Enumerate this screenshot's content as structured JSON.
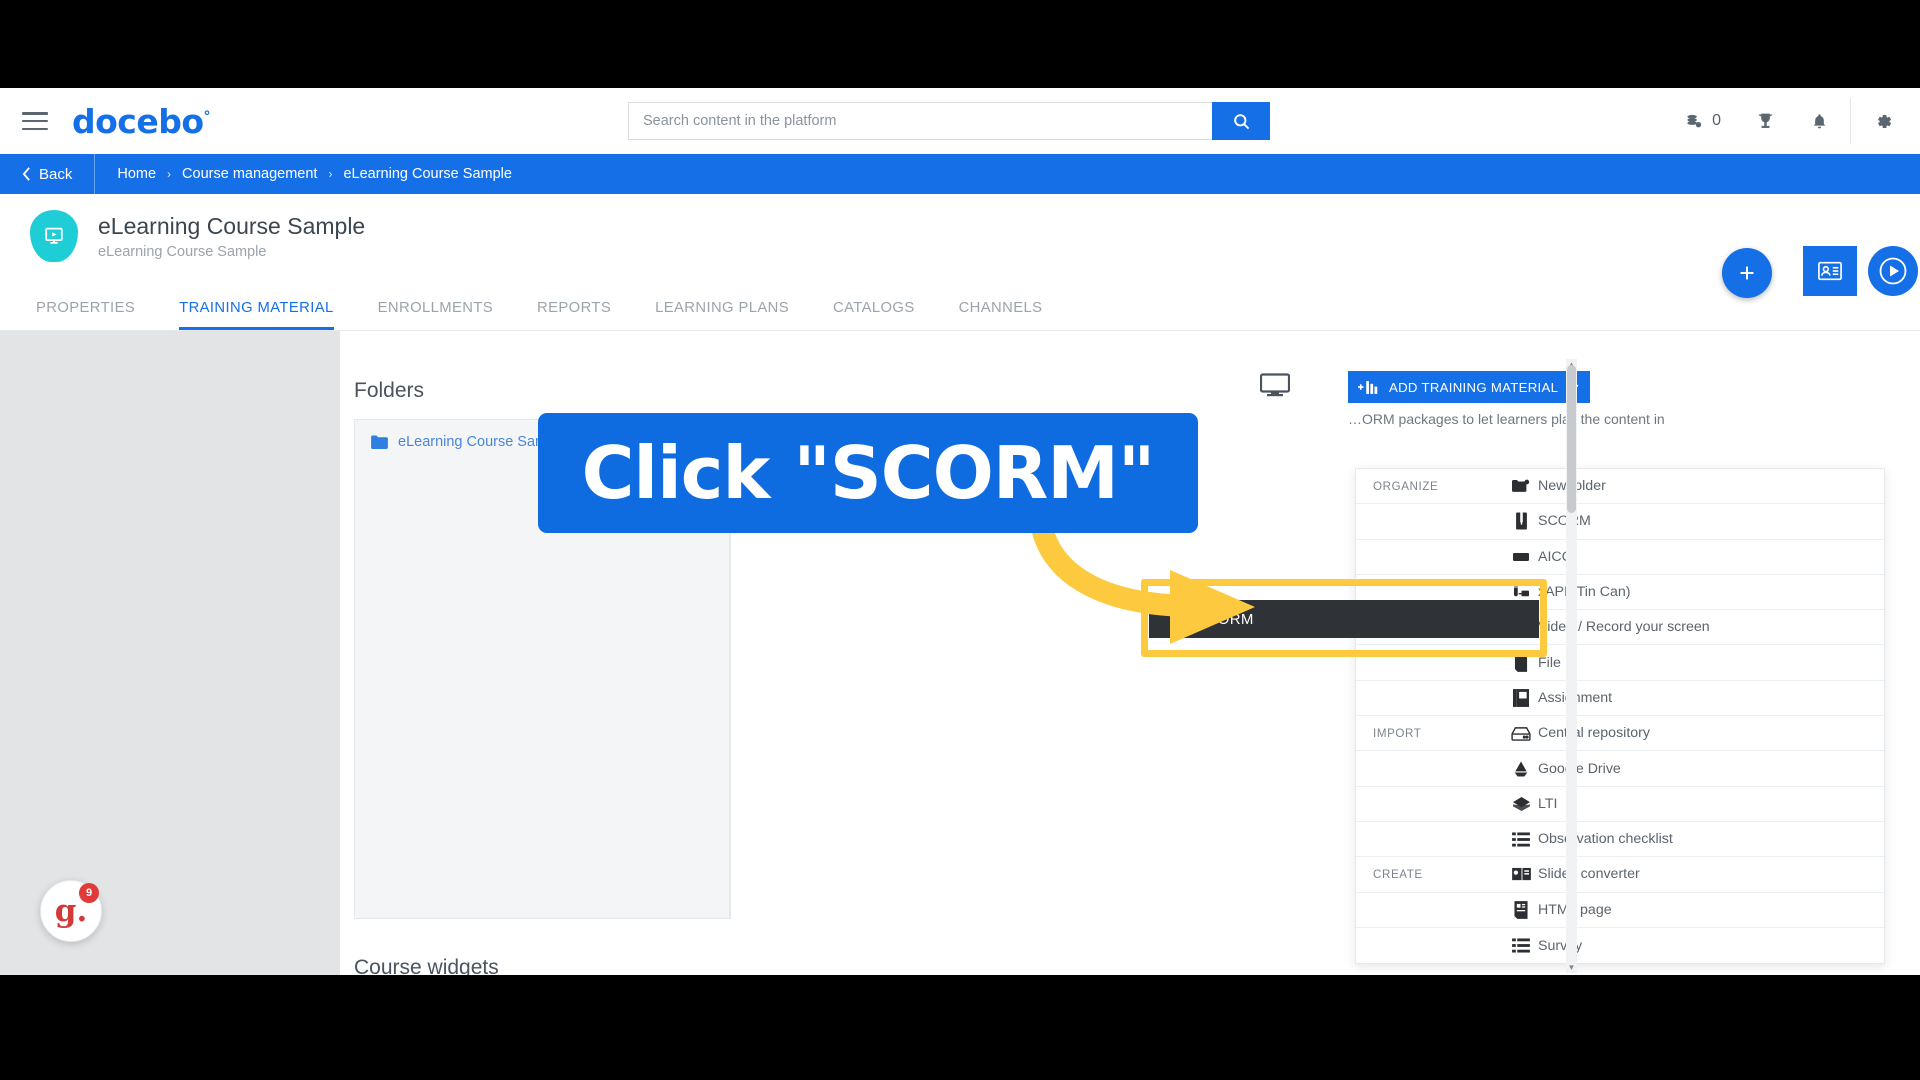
{
  "app": {
    "logo": "docebo",
    "logo_mark": "°"
  },
  "search": {
    "placeholder": "Search content in the platform",
    "value": "",
    "icon": "search-icon"
  },
  "header_right": {
    "coin_count": "0",
    "icons": [
      "coins-icon",
      "trophy-icon",
      "bell-icon",
      "gear-icon"
    ]
  },
  "breadcrumb": {
    "back_label": "Back",
    "items": [
      "Home",
      "Course management",
      "eLearning Course Sample"
    ],
    "separator": "›"
  },
  "course": {
    "title": "eLearning Course Sample",
    "subtitle": "eLearning Course Sample",
    "icon": "course-player-icon",
    "icon_color": "#1fcdd7"
  },
  "tabs": [
    {
      "label": "PROPERTIES",
      "active": false
    },
    {
      "label": "TRAINING MATERIAL",
      "active": true
    },
    {
      "label": "ENROLLMENTS",
      "active": false
    },
    {
      "label": "REPORTS",
      "active": false
    },
    {
      "label": "LEARNING PLANS",
      "active": false
    },
    {
      "label": "CATALOGS",
      "active": false
    },
    {
      "label": "CHANNELS",
      "active": false
    }
  ],
  "main": {
    "folders_title": "Folders",
    "folder_item": "eLearning Course Sample",
    "course_widgets_title": "Course widgets",
    "add_button_label": "ADD TRAINING MATERIAL",
    "add_button_caret": "▼",
    "hint_text": "…ORM packages to let learners play the content in"
  },
  "dropdown": {
    "groups": {
      "organize": "ORGANIZE",
      "import": "IMPORT",
      "create": "CREATE"
    },
    "items": [
      {
        "group": "ORGANIZE",
        "label": "New folder",
        "icon": "new-folder-icon"
      },
      {
        "group": "",
        "label": "SCORM",
        "icon": "scorm-icon",
        "highlighted": true
      },
      {
        "group": "",
        "label": "AICC",
        "icon": "aicc-icon"
      },
      {
        "group": "",
        "label": "xAPI (Tin Can)",
        "icon": "xapi-icon"
      },
      {
        "group": "",
        "label": "Video / Record your screen",
        "icon": "video-icon"
      },
      {
        "group": "",
        "label": "File",
        "icon": "file-icon"
      },
      {
        "group": "",
        "label": "Assignment",
        "icon": "assignment-icon"
      },
      {
        "group": "IMPORT",
        "label": "Central repository",
        "icon": "central-repository-icon"
      },
      {
        "group": "",
        "label": "Google Drive",
        "icon": "google-drive-icon"
      },
      {
        "group": "",
        "label": "LTI",
        "icon": "lti-icon"
      },
      {
        "group": "",
        "label": "Observation checklist",
        "icon": "observation-checklist-icon"
      },
      {
        "group": "CREATE",
        "label": "Slides converter",
        "icon": "slides-converter-icon"
      },
      {
        "group": "",
        "label": "HTML page",
        "icon": "html-page-icon"
      },
      {
        "group": "",
        "label": "Survey",
        "icon": "survey-icon"
      }
    ]
  },
  "callout": {
    "text": "Click \"SCORM\"",
    "background": "#0f6ce0",
    "arrow_color": "#fcc93f",
    "highlight_color": "#fcc93f"
  },
  "widget_badge": {
    "letter": "g.",
    "count": "9",
    "color": "#d23939"
  },
  "colors": {
    "brand_blue": "#1570e8",
    "accent_teal": "#1fcdd7",
    "highlight_yellow": "#fcc93f"
  }
}
